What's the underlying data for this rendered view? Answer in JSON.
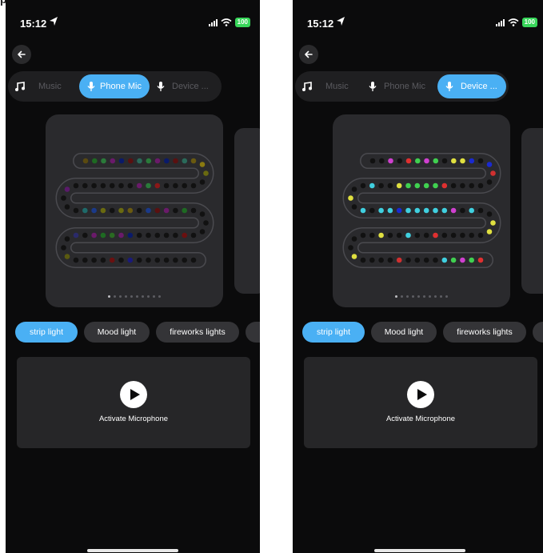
{
  "corner_text": "p",
  "screens": [
    {
      "id": "left",
      "status": {
        "time": "15:12",
        "battery": "100"
      },
      "tabs": [
        {
          "label": "Music",
          "icon": "music-note-icon",
          "active": false
        },
        {
          "label": "Phone Mic",
          "icon": "microphone-icon",
          "active": true
        },
        {
          "label": "Device ...",
          "icon": "microphone-icon",
          "active": false
        }
      ],
      "pager": {
        "count": 10,
        "active": 0
      },
      "modes": [
        {
          "label": "strip light",
          "active": true
        },
        {
          "label": "Mood light",
          "active": false
        },
        {
          "label": "fireworks lights",
          "active": false
        }
      ],
      "mic_label": "Activate Microphone",
      "led_colors": [
        "#5a4a10",
        "#1e6a22",
        "#2a7a3a",
        "#6a1a6a",
        "#0a1a6a",
        "#5a1010",
        "#2a6a5a",
        "#2a7a3a",
        "#6a1a6a",
        "#0a1a6a",
        "#5a1010",
        "#2a6a5a",
        "#6a5a10",
        "#8a7a10",
        "#6a6a10",
        "#111111",
        "#111111",
        "#111111",
        "#111111",
        "#111111",
        "#8a1818",
        "#2a7a3a",
        "#6a1a6a",
        "#111111",
        "#111111",
        "#111111",
        "#111111",
        "#111111",
        "#111111",
        "#111111",
        "#5a1a6a",
        "#111111",
        "#111111",
        "#111111",
        "#1e6a6a",
        "#1a3a8a",
        "#6a6a10",
        "#111111",
        "#6a6a10",
        "#6a5a10",
        "#111111",
        "#1a3a8a",
        "#5a1010",
        "#6a1a6a",
        "#111111",
        "#1e6a22",
        "#111111",
        "#111111",
        "#111111",
        "#111111",
        "#111111",
        "#6a1010",
        "#111111",
        "#111111",
        "#111111",
        "#111111",
        "#111111",
        "#0a1a6a",
        "#6a1a6a",
        "#2a6a22",
        "#1e6a22",
        "#6a1a6a",
        "#111111",
        "#2a2a6a",
        "#111111",
        "#111111",
        "#5a5a10",
        "#111111",
        "#111111",
        "#111111",
        "#111111",
        "#6a1010",
        "#111111",
        "#1a1a7a",
        "#111111",
        "#111111",
        "#111111",
        "#111111",
        "#111111",
        "#111111",
        "#111111",
        "#111111",
        "#6a1a6a",
        "#111111",
        "#6a6a10",
        "#111111",
        "#111111"
      ]
    },
    {
      "id": "right",
      "status": {
        "time": "15:12",
        "battery": "100"
      },
      "tabs": [
        {
          "label": "Music",
          "icon": "music-note-icon",
          "active": false
        },
        {
          "label": "Phone Mic",
          "icon": "microphone-icon",
          "active": false
        },
        {
          "label": "Device ...",
          "icon": "microphone-icon",
          "active": true
        }
      ],
      "pager": {
        "count": 10,
        "active": 0
      },
      "modes": [
        {
          "label": "strip light",
          "active": true
        },
        {
          "label": "Mood light",
          "active": false
        },
        {
          "label": "fireworks lights",
          "active": false
        }
      ],
      "mic_label": "Activate Microphone",
      "led_colors": [
        "#111111",
        "#111111",
        "#d040d0",
        "#111111",
        "#e03030",
        "#40d050",
        "#d040d0",
        "#40d050",
        "#111111",
        "#e0e040",
        "#e0e040",
        "#1a2ad0",
        "#111111",
        "#1a2ad0",
        "#d03030",
        "#111111",
        "#111111",
        "#111111",
        "#111111",
        "#111111",
        "#e03030",
        "#40d050",
        "#40d050",
        "#40d050",
        "#40d050",
        "#e0e040",
        "#111111",
        "#111111",
        "#40d0e0",
        "#111111",
        "#111111",
        "#e0e040",
        "#111111",
        "#40d0e0",
        "#111111",
        "#40d0e0",
        "#40d0e0",
        "#1a2ad0",
        "#40d0e0",
        "#40d0e0",
        "#40d0e0",
        "#40d0e0",
        "#40d0e0",
        "#d040d0",
        "#111111",
        "#40d0e0",
        "#111111",
        "#111111",
        "#e0e040",
        "#e0e040",
        "#111111",
        "#111111",
        "#111111",
        "#111111",
        "#111111",
        "#e03030",
        "#111111",
        "#111111",
        "#40d0e0",
        "#111111",
        "#111111",
        "#e0e040",
        "#111111",
        "#111111",
        "#111111",
        "#111111",
        "#e0e040",
        "#111111",
        "#111111",
        "#111111",
        "#111111",
        "#d03030",
        "#111111",
        "#111111",
        "#111111",
        "#111111",
        "#40d0e0",
        "#40d050",
        "#d040d0",
        "#40d050",
        "#e03030",
        "#1a2ad0",
        "#111111",
        "#111111",
        "#111111",
        "#40d050",
        "#111111"
      ]
    }
  ]
}
